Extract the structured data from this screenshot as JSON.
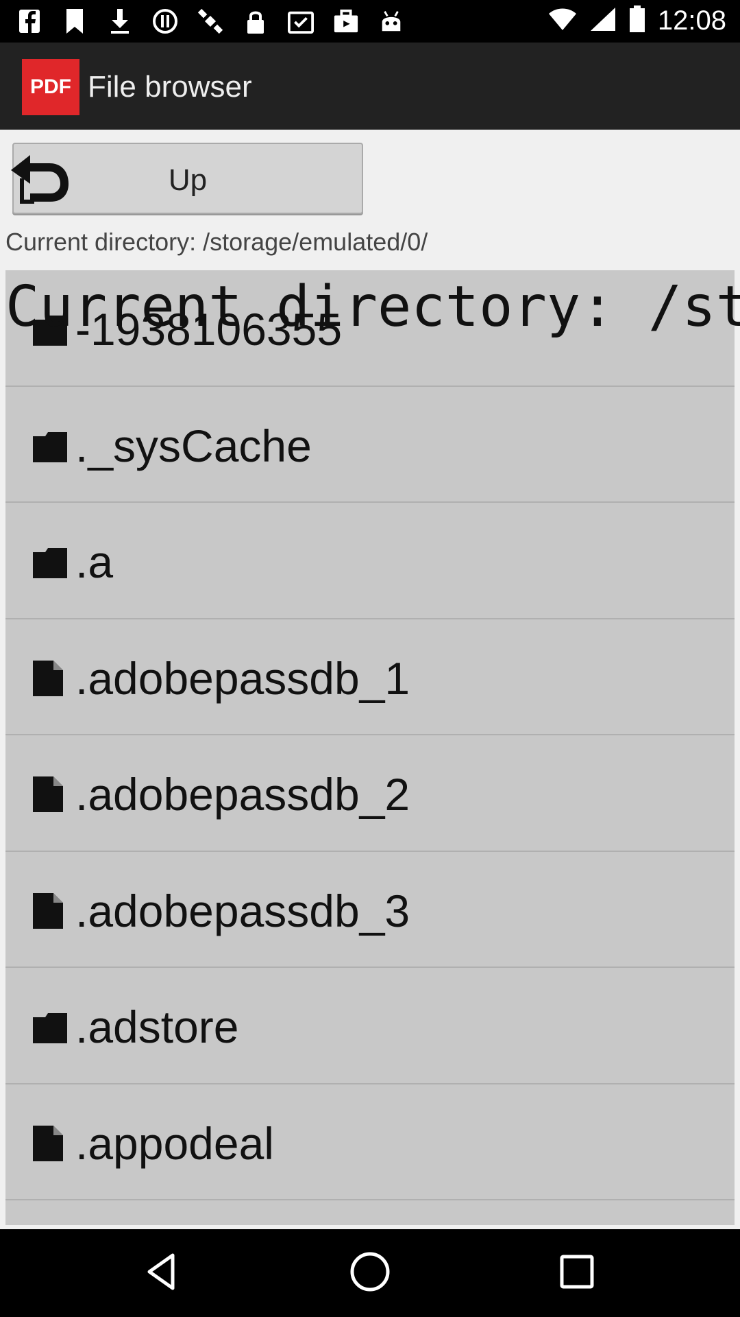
{
  "status_bar": {
    "time": "12:08",
    "icons": [
      "facebook-icon",
      "bookmark-icon",
      "download-icon",
      "alert-icon",
      "satellite-icon",
      "lock-icon",
      "clipboard-icon",
      "briefcase-icon",
      "android-icon"
    ]
  },
  "app_bar": {
    "logo_text": "PDF",
    "title": "File browser"
  },
  "up_button": {
    "label": "Up"
  },
  "current_directory": "Current directory: /storage/emulated/0/",
  "overlay_text": "Current directory: /storage",
  "files": [
    {
      "name": "-1938106355",
      "type": "folder"
    },
    {
      "name": "._sysCache",
      "type": "folder"
    },
    {
      "name": ".a",
      "type": "folder"
    },
    {
      "name": ".adobepassdb_1",
      "type": "file"
    },
    {
      "name": ".adobepassdb_2",
      "type": "file"
    },
    {
      "name": ".adobepassdb_3",
      "type": "file"
    },
    {
      "name": ".adstore",
      "type": "folder"
    },
    {
      "name": ".appodeal",
      "type": "file"
    }
  ],
  "colors": {
    "accent": "#e0272a",
    "app_bar": "#222222",
    "list_bg": "#c8c8c8"
  }
}
